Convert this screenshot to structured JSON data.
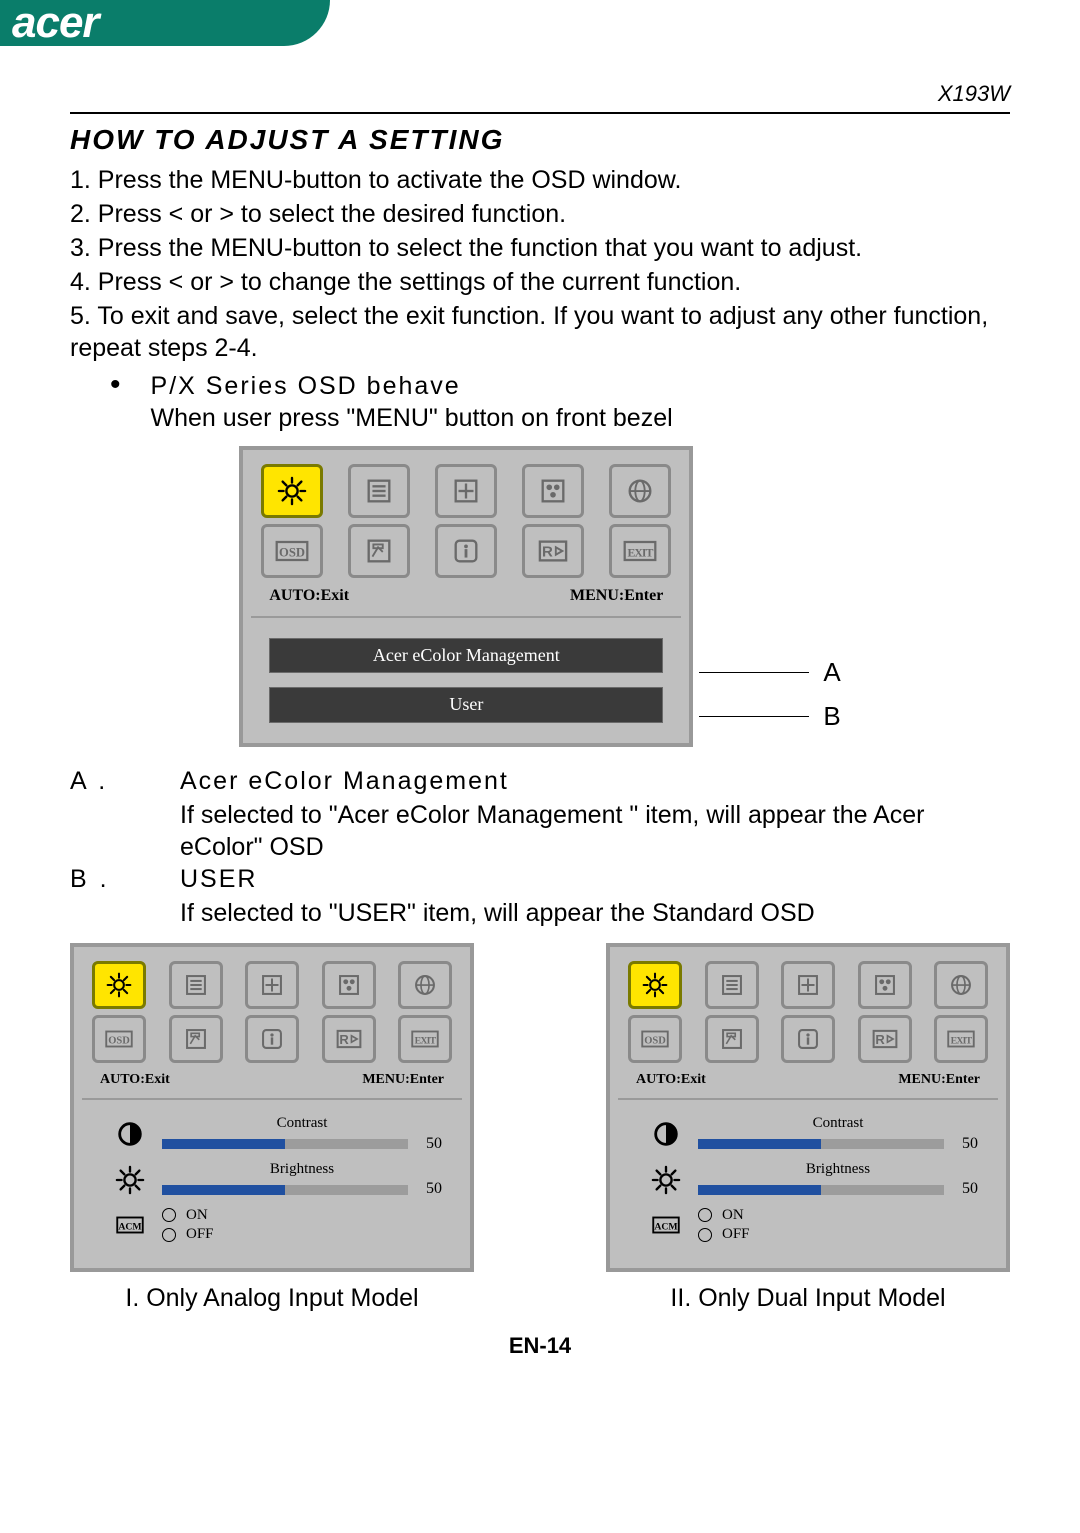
{
  "brand": "acer",
  "model": "X193W",
  "title": "HOW TO ADJUST A SETTING",
  "steps": [
    "1. Press the MENU-button  to activate the OSD window.",
    "2. Press < or  > to select the desired function.",
    "3. Press the MENU-button  to select the function that you want to adjust.",
    "4. Press < or  > to change the settings of the current function.",
    "5. To exit and save, select the exit function. If you want to adjust any other function, repeat steps 2-4."
  ],
  "series_head": "P/X Series OSD behave",
  "series_line": "When user press \"MENU\" button on front bezel",
  "osd": {
    "icons_row1": [
      "brightness-icon",
      "text-icon",
      "position-icon",
      "color-icon",
      "language-icon"
    ],
    "icons_row2": [
      "osd-icon",
      "signal-icon",
      "info-icon",
      "reset-icon",
      "exit-icon"
    ],
    "hint_left": "AUTO:Exit",
    "hint_right": "MENU:Enter",
    "menu_items": [
      "Acer eColor Management",
      "User"
    ],
    "side_labels": [
      "A",
      "B"
    ],
    "settings": {
      "contrast_label": "Contrast",
      "contrast_value": "50",
      "brightness_label": "Brightness",
      "brightness_value": "50",
      "acm_on": "ON",
      "acm_off": "OFF"
    }
  },
  "defs": {
    "A_key": "A .",
    "A_head": "Acer eColor Management",
    "A_body": "If selected to \"Acer eColor Management \" item, will appear the Acer eColor\" OSD",
    "B_key": "B .",
    "B_head": "USER",
    "B_body": "If selected to \"USER\" item, will appear the Standard OSD"
  },
  "captions": {
    "left": "I. Only Analog Input Model",
    "right": "II. Only Dual Input Model"
  },
  "footer": "EN-14"
}
